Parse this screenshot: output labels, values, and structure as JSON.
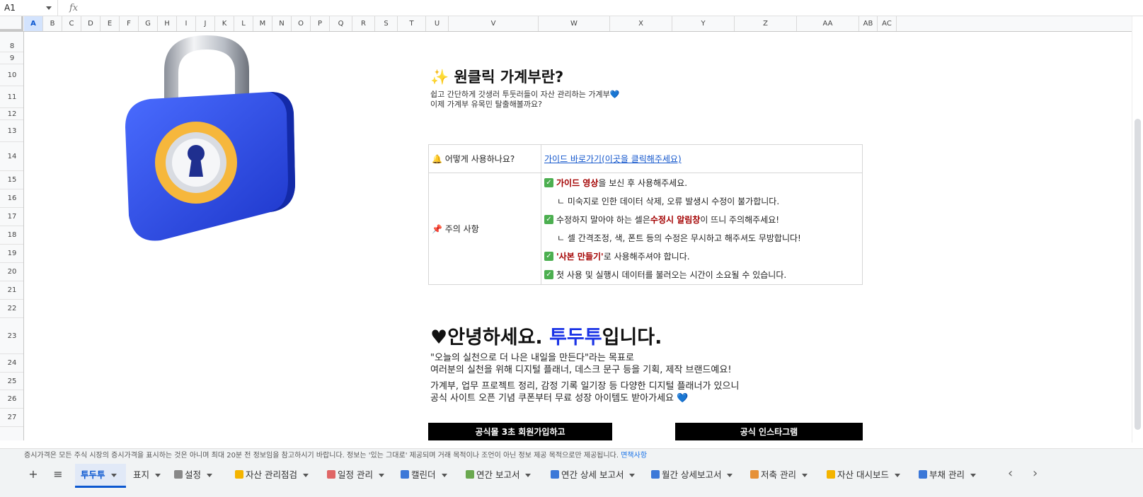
{
  "formula_bar": {
    "cell_ref": "A1",
    "fx_label": "fx"
  },
  "columns": [
    "A",
    "B",
    "C",
    "D",
    "E",
    "F",
    "G",
    "H",
    "I",
    "J",
    "K",
    "L",
    "M",
    "N",
    "O",
    "P",
    "Q",
    "R",
    "S",
    "T",
    "U",
    "V",
    "W",
    "X",
    "Y",
    "Z",
    "AA",
    "AB",
    "AC"
  ],
  "rows": [
    "8",
    "9",
    "10",
    "11",
    "12",
    "13",
    "14",
    "15",
    "16",
    "17",
    "18",
    "19",
    "20",
    "21",
    "22",
    "23",
    "24",
    "25",
    "26",
    "27"
  ],
  "intro": {
    "title": "✨ 원클릭 가계부란?",
    "line1": "쉽고 간단하게 갓생러 투둣러들이 자산 관리하는 가계부💙",
    "line2": "이제 가계부 유목민 탈출해볼까요?"
  },
  "info_table": {
    "how_label": "🔔 어떻게 사용하나요?",
    "guide_link": "가이드 바로가기(이곳을 클릭해주세요)",
    "caution_label": "📌 주의 사항",
    "n1_hl": "가이드 영상",
    "n1_rest": "을 보신 후 사용해주세요.",
    "n2": "ㄴ 미숙지로 인한 데이터 삭제, 오류 발생시 수정이 불가합니다.",
    "n3_pre": "수정하지 말아야 하는 셀은 ",
    "n3_hl": "수정시 알림창",
    "n3_post": "이 뜨니 주의해주세요!",
    "n4": "ㄴ 셀 간격조정, 색, 폰트 등의 수정은 무시하고 해주셔도 무방합니다!",
    "n5_hl": "'사본 만들기'",
    "n5_rest": "로 사용해주셔야 합니다.",
    "n6": "첫 사용 및 실행시 데이터를 불러오는 시간이 소요될 수 있습니다."
  },
  "hello": {
    "heart": "♥",
    "pre": "안녕하세요. ",
    "brand": "투두투",
    "post": "입니다.",
    "l1": "\"오늘의 실천으로 더 나은 내일을 만든다\"라는 목표로",
    "l2": "여러분의 실천을 위해 디지털 플래너, 데스크 문구 등을 기획, 제작 브랜드예요!",
    "l3": "가계부, 업무 프로젝트 정리, 감정 기록 일기장 등 다양한 디지털 플래너가 있으니",
    "l4": "공식 사이트 오픈 기념 쿠폰부터 무료 성장 아이템도 받아가세요 💙"
  },
  "buttons": {
    "mall": "공식몰 3초 회원가입하고",
    "insta": "공식 인스타그램"
  },
  "notice": {
    "text": "증시가격은 모든 주식 시장의 증시가격을 표시하는 것은 아니며 최대 20분 전 정보임을 참고하시기 바랍니다. 정보는 '있는 그대로' 제공되며 거래 목적이나 조언이 아닌 정보 제공 목적으로만 제공됩니다. ",
    "link": "면책사항"
  },
  "tabs": [
    {
      "label": "투두투",
      "active": true,
      "color": ""
    },
    {
      "label": "표지",
      "active": false,
      "color": ""
    },
    {
      "label": "설정",
      "active": false,
      "color": "#888888"
    },
    {
      "label": "자산 관리점검",
      "active": false,
      "color": "#f4b400"
    },
    {
      "label": "일정 관리",
      "active": false,
      "color": "#e06666"
    },
    {
      "label": "캘린더",
      "active": false,
      "color": "#3c78d8"
    },
    {
      "label": "연간 보고서",
      "active": false,
      "color": "#6aa84f"
    },
    {
      "label": "연간 상세 보고서",
      "active": false,
      "color": "#3c78d8"
    },
    {
      "label": "월간 상세보고서",
      "active": false,
      "color": "#3c78d8"
    },
    {
      "label": "저축 관리",
      "active": false,
      "color": "#e69138"
    },
    {
      "label": "자산 대시보드",
      "active": false,
      "color": "#f4b400"
    },
    {
      "label": "부채 관리",
      "active": false,
      "color": "#3c78d8"
    }
  ],
  "colors": {
    "brand_blue": "#1a33e6",
    "highlight_red": "#a30000",
    "link_blue": "#1155cc"
  }
}
